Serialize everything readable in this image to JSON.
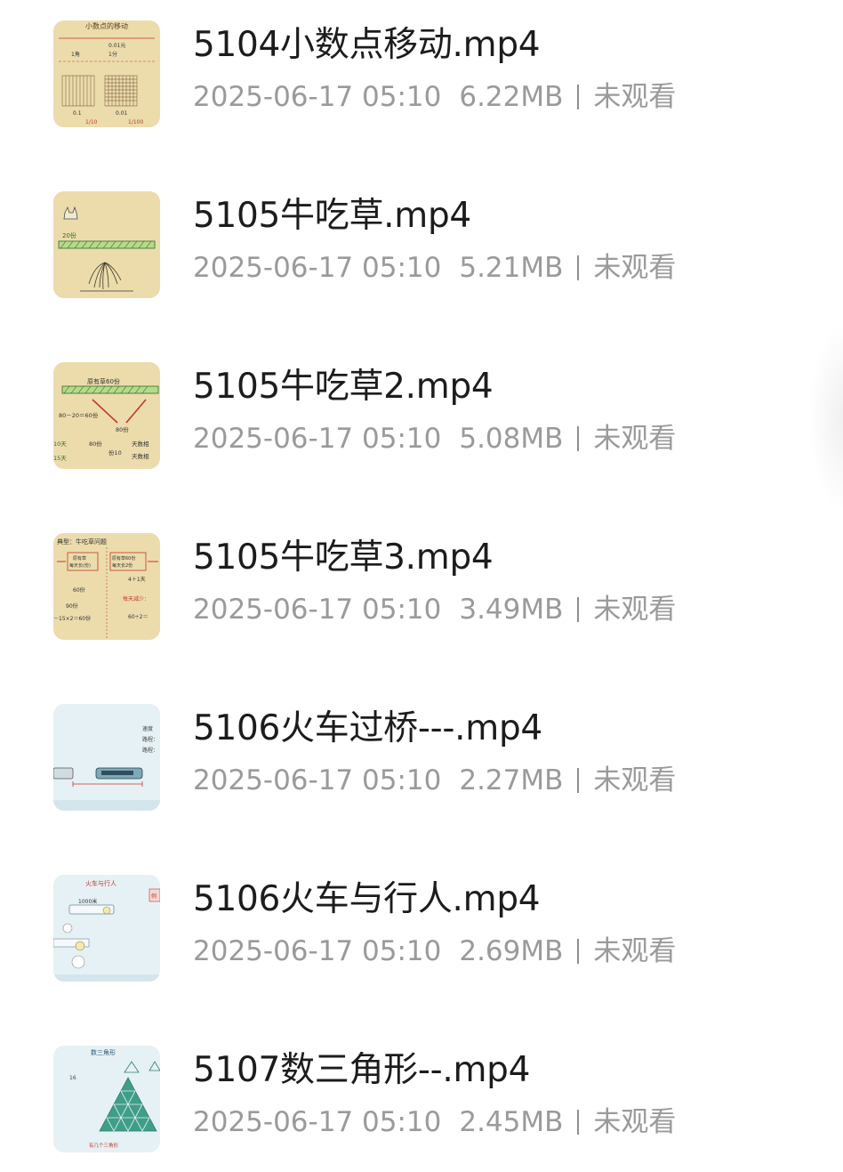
{
  "files": [
    {
      "name": "5104小数点移动.mp4",
      "date": "2025-06-17 05:10",
      "size": "6.22MB",
      "status": "未观看",
      "thumbnail": {
        "title": "小数点的移动",
        "t1": "0.01元",
        "t2": "1角",
        "t3": "1分",
        "t4": "0.1",
        "t5": "0.01",
        "fraction1": "1/10",
        "fraction2": "1/100"
      }
    },
    {
      "name": "5105牛吃草.mp4",
      "date": "2025-06-17 05:10",
      "size": "5.21MB",
      "status": "未观看",
      "thumbnail": {
        "label": "20份"
      }
    },
    {
      "name": "5105牛吃草2.mp4",
      "date": "2025-06-17 05:10",
      "size": "5.08MB",
      "status": "未观看",
      "thumbnail": {
        "label": "原有草60份",
        "eq": "80－20＝60份",
        "v1": "80份",
        "v2": "10天",
        "v3": "15天",
        "v4": "天数相",
        "v5": "天数相"
      }
    },
    {
      "name": "5105牛吃草3.mp4",
      "date": "2025-06-17 05:10",
      "size": "3.49MB",
      "status": "未观看",
      "thumbnail": {
        "title": "典型：牛吃草问题",
        "b1": "原有草",
        "b2": "每天长(份)",
        "b3": "原有草60份",
        "b4": "每天长2份",
        "v1": "60份",
        "v2": "90份",
        "eq": "－15×2＝60份",
        "v3": "4＋1天",
        "v4": "每天减少：",
        "v5": "60÷2＝"
      }
    },
    {
      "name": "5106火车过桥---.mp4",
      "date": "2025-06-17 05:10",
      "size": "2.27MB",
      "status": "未观看",
      "thumbnail": {
        "l1": "速度",
        "l2": "路程：",
        "l3": "路程："
      }
    },
    {
      "name": "5106火车与行人.mp4",
      "date": "2025-06-17 05:10",
      "size": "2.69MB",
      "status": "未观看",
      "thumbnail": {
        "title": "火车与行人",
        "dist": "1000米",
        "tag": "例"
      }
    },
    {
      "name": "5107数三角形--.mp4",
      "date": "2025-06-17 05:10",
      "size": "2.45MB",
      "status": "未观看",
      "thumbnail": {
        "title": "数三角形",
        "n": "16",
        "caption": "有几个三角形"
      }
    }
  ],
  "colors": {
    "name_text": "#1c1c1c",
    "meta_text": "#9a9a9a",
    "paper_thumb": "#ecdcac",
    "ice_thumb": "#e6f1f5"
  }
}
